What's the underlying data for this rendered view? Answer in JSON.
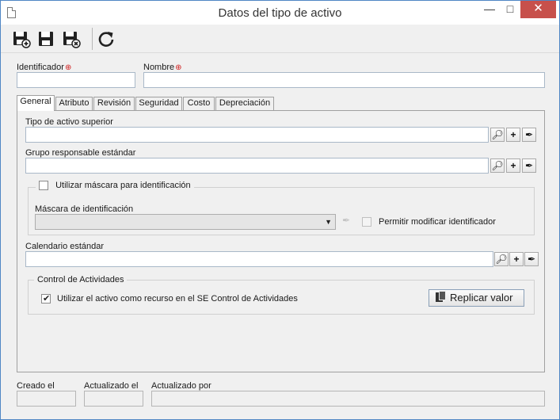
{
  "window": {
    "title": "Datos del tipo de activo",
    "minimize": "—",
    "maximize": "□",
    "close": "✕"
  },
  "toolbar": {
    "buttons": [
      {
        "icon": "save-new-icon",
        "tooltip": ""
      },
      {
        "icon": "save-icon",
        "tooltip": ""
      },
      {
        "icon": "save-close-icon",
        "tooltip": ""
      },
      {
        "icon": "refresh-icon",
        "tooltip": ""
      }
    ]
  },
  "header": {
    "identifier_label": "Identificador",
    "identifier_value": "",
    "name_label": "Nombre",
    "name_value": "",
    "required_mark": "⊕"
  },
  "tabs": [
    {
      "label": "General",
      "active": true
    },
    {
      "label": "Atributo"
    },
    {
      "label": "Revisión"
    },
    {
      "label": "Seguridad"
    },
    {
      "label": "Costo"
    },
    {
      "label": "Depreciación"
    }
  ],
  "general": {
    "parent_type_label": "Tipo de activo superior",
    "parent_type_value": "",
    "responsible_group_label": "Grupo responsable estándar",
    "responsible_group_value": "",
    "mask_group": {
      "checkbox_label": "Utilizar máscara para identificación",
      "checked": false,
      "mask_label": "Máscara de identificación",
      "mask_value": "",
      "allow_modify_label": "Permitir modificar identificador",
      "allow_modify_checked": false
    },
    "calendar_label": "Calendario estándar",
    "calendar_value": "",
    "activity_group": {
      "legend": "Control de Actividades",
      "checkbox_label": "Utilizar el activo como recurso en el SE Control de Actividades",
      "checked": true,
      "replicate_button": "Replicar valor"
    }
  },
  "footer": {
    "created_label": "Creado el",
    "created_value": "",
    "updated_label": "Actualizado el",
    "updated_value": "",
    "updated_by_label": "Actualizado por",
    "updated_by_value": ""
  },
  "colors": {
    "accent": "#4f86c4",
    "close": "#c7504b",
    "required": "#d02020"
  }
}
